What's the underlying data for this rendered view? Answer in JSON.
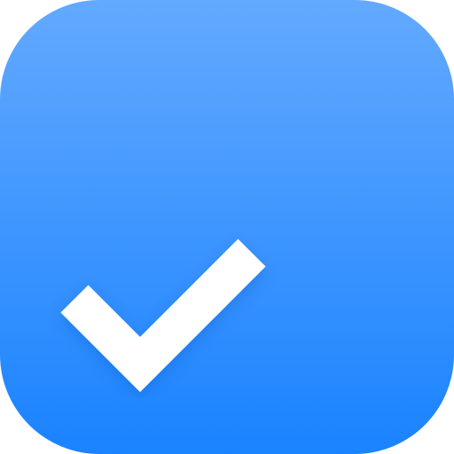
{
  "app_icon": {
    "name": "task-complete-app-icon",
    "colors": {
      "gradient_top": "#63A9FF",
      "gradient_bottom": "#1A83FF",
      "checkmark": "#FFFFFF",
      "shadow": "#0A4BB3"
    },
    "icon_semantic": "checkmark-icon"
  }
}
